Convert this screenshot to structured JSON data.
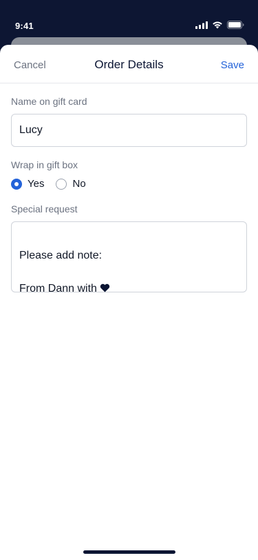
{
  "status_bar": {
    "time": "9:41",
    "icons": [
      "signal-icon",
      "wifi-icon",
      "battery-icon"
    ]
  },
  "nav": {
    "cancel_label": "Cancel",
    "title": "Order Details",
    "save_label": "Save"
  },
  "form": {
    "gift_card_name": {
      "label": "Name on gift card",
      "value": "Lucy"
    },
    "gift_box": {
      "label": "Wrap in gift box",
      "options": [
        {
          "label": "Yes",
          "selected": true
        },
        {
          "label": "No",
          "selected": false
        }
      ]
    },
    "special_request": {
      "label": "Special request",
      "line1": "Please add note:",
      "line2": "From Dann with",
      "icon": "heart-icon"
    }
  },
  "colors": {
    "accent": "#2463d9",
    "dark": "#0b1533",
    "muted": "#6b7280"
  }
}
